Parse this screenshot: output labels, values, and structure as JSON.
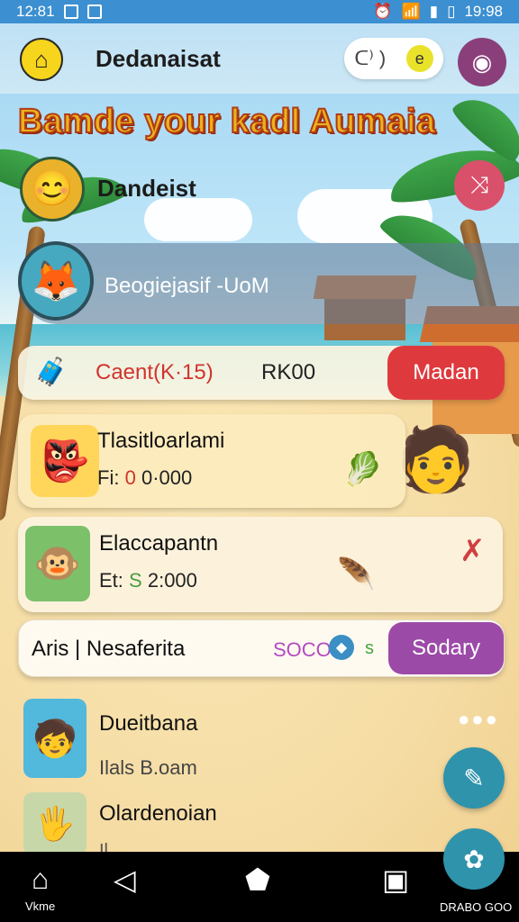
{
  "status": {
    "time": "12:81",
    "right_time": "19:98"
  },
  "header": {
    "title": "Dedanaisat",
    "pill_left": "ᑕ⁾ )",
    "pill_right": "e"
  },
  "banner": "Bamde your kadl Aumaia",
  "rows": {
    "first": {
      "label": "Dandeist"
    },
    "second": {
      "label": "Beogiejasif -UoM"
    }
  },
  "cards": {
    "promo": {
      "code": "Caent(K·15)",
      "price": "RK00",
      "button": "Madan"
    },
    "item1": {
      "name": "Tlasitloarlami",
      "meta_prefix": "Fi:",
      "meta_dot": "0",
      "meta_value": "0·000"
    },
    "item2": {
      "name": "Elaccapantn",
      "meta_prefix": "Et:",
      "meta_dot": "S",
      "meta_value": "2:000"
    },
    "bar": {
      "label": "Aris | Nesaferita",
      "amount": "SOCO",
      "suffix": "s",
      "button": "Sodary"
    },
    "item3": {
      "name": "Dueitbana",
      "meta": "Ilals B.oam"
    },
    "item4": {
      "name": "Olardenoian",
      "meta": "Il..."
    }
  },
  "nav": {
    "home_label": "Vkme",
    "drabo": "DRABO GOO"
  },
  "icons": {
    "back": "home-icon",
    "camera": "camera-icon",
    "share": "share-icon",
    "fab1": "edit-icon",
    "fab2": "settings-icon"
  },
  "colors": {
    "status_bar": "#3c8fd0",
    "promo_button": "#de3a3e",
    "bar_button": "#9c4aa8",
    "fab": "#2f93ac"
  }
}
